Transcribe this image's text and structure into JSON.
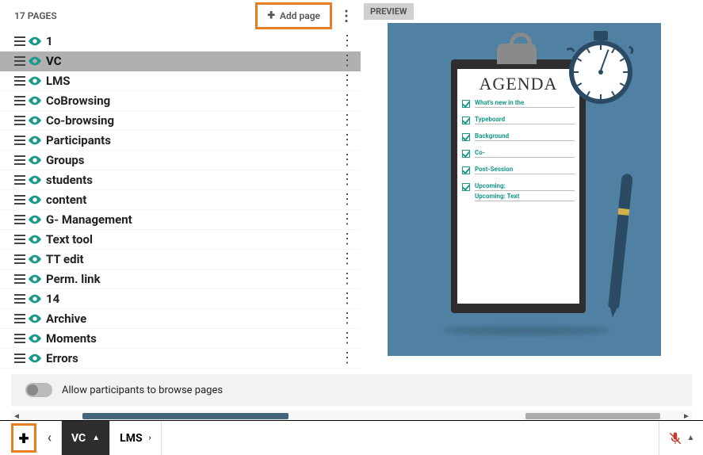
{
  "header": {
    "pages_count_label": "17 PAGES",
    "add_page_label": "Add page"
  },
  "pages": [
    {
      "label": "1",
      "selected": false
    },
    {
      "label": "VC",
      "selected": true
    },
    {
      "label": "LMS",
      "selected": false
    },
    {
      "label": "CoBrowsing",
      "selected": false
    },
    {
      "label": "Co-browsing",
      "selected": false
    },
    {
      "label": "Participants",
      "selected": false
    },
    {
      "label": "Groups",
      "selected": false
    },
    {
      "label": "students",
      "selected": false
    },
    {
      "label": "content",
      "selected": false
    },
    {
      "label": "G- Management",
      "selected": false
    },
    {
      "label": "Text tool",
      "selected": false
    },
    {
      "label": "TT edit",
      "selected": false
    },
    {
      "label": "Perm. link",
      "selected": false
    },
    {
      "label": "14",
      "selected": false
    },
    {
      "label": "Archive",
      "selected": false
    },
    {
      "label": "Moments",
      "selected": false
    },
    {
      "label": "Errors",
      "selected": false
    }
  ],
  "preview": {
    "badge": "PREVIEW",
    "agenda_title": "AGENDA",
    "agenda_items": [
      "What's new in the",
      "Typeboard",
      "Background",
      "Co-",
      "Post-Session",
      "Upcoming:"
    ],
    "agenda_sub": "Upcoming: Text"
  },
  "toggle": {
    "label": "Allow participants to browse pages",
    "state": false
  },
  "bottom": {
    "tab_active": "VC",
    "tab_next": "LMS"
  },
  "colors": {
    "accent_orange": "#e67e22",
    "teal": "#1a998a",
    "preview_bg": "#5081a3"
  }
}
